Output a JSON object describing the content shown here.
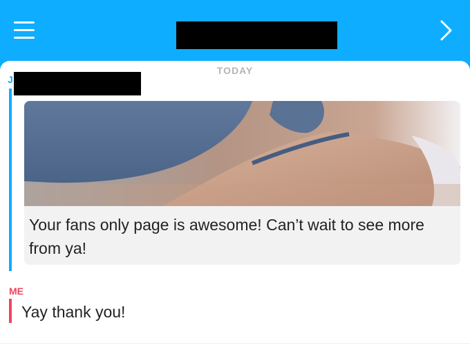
{
  "header": {
    "title_redacted": true,
    "menu_icon": "hamburger-menu-icon",
    "forward_icon": "chevron-right-icon",
    "color": "#0eadff"
  },
  "chat": {
    "date_separator": "TODAY",
    "messages": [
      {
        "from": "them",
        "sender_initial": "J",
        "sender_name_redacted": true,
        "accent_color": "#0eadff",
        "attachment": "snap-image",
        "text": "Your fans only page is awesome! Can’t wait to see more from ya!"
      },
      {
        "from": "me",
        "sender_label": "ME",
        "accent_color": "#f0435e",
        "text": "Yay thank you!"
      }
    ]
  }
}
